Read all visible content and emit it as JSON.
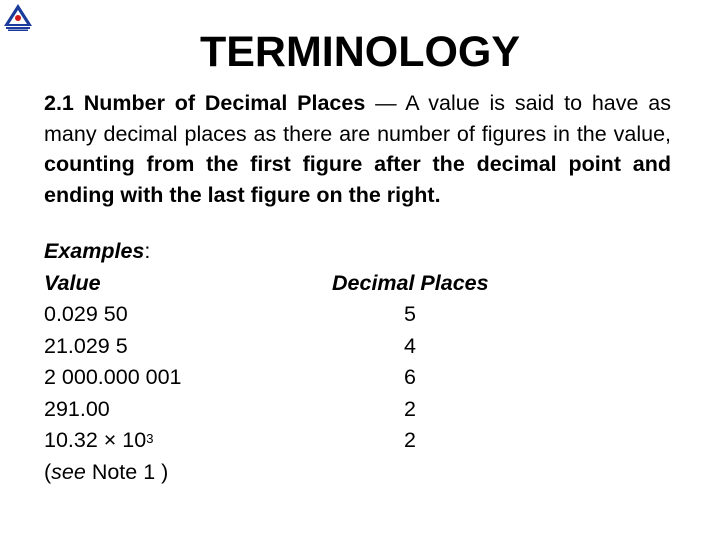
{
  "logo": {
    "icon": "bis-logo-icon"
  },
  "title": "TERMINOLOGY",
  "paragraph": {
    "heading": "2.1 Number of Decimal Places",
    "dash": " — ",
    "text1": "A value is said to have as many decimal places as there are number of figures in the value, ",
    "bold_text": "counting from the first figure after the decimal point and ending with the last figure on the right."
  },
  "examples": {
    "label": "Examples",
    "colon": ":",
    "col_value": "Value",
    "col_places": "Decimal Places",
    "rows": [
      {
        "value": "0.029 50",
        "places": "5"
      },
      {
        "value": "21.029 5",
        "places": "4"
      },
      {
        "value": "2 000.000 001",
        "places": "6"
      },
      {
        "value": "291.00",
        "places": "2"
      },
      {
        "value_base": "10.32 × 10",
        "value_exp": "3",
        "places": "2"
      }
    ],
    "note_open": "(",
    "note_see": "see",
    "note_rest": " Note 1 )"
  }
}
